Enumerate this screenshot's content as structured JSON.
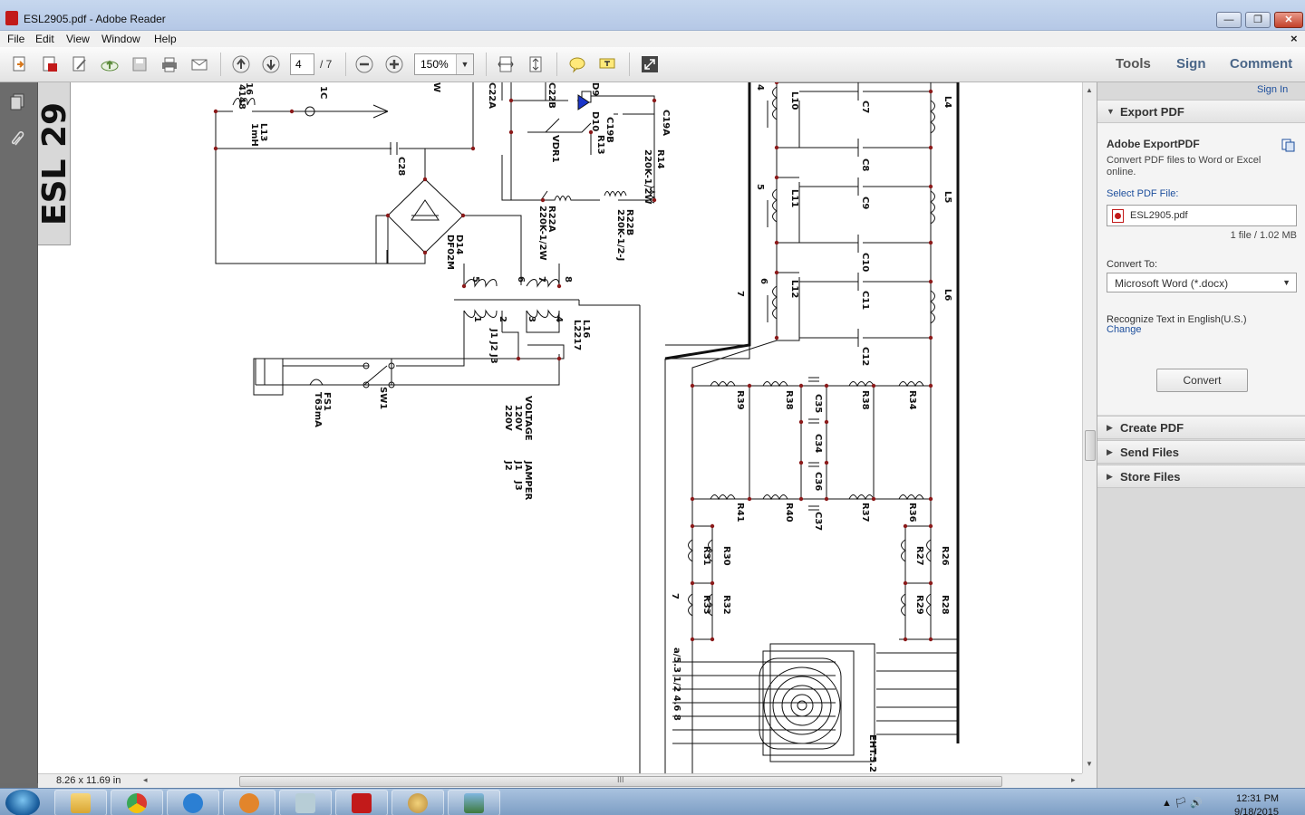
{
  "window": {
    "title": "ESL2905.pdf - Adobe Reader",
    "min": "—",
    "max": "❐",
    "close": "✕"
  },
  "menu": {
    "items": [
      "File",
      "Edit",
      "View",
      "Window",
      "Help"
    ],
    "doc_close": "×"
  },
  "toolbar": {
    "page_current": "4",
    "page_total": "/ 7",
    "zoom": "150%",
    "tabs": {
      "tools": "Tools",
      "sign": "Sign",
      "comment": "Comment"
    }
  },
  "document": {
    "banner_text": "ESL 29",
    "labels": {
      "l13": "L13",
      "l13_val": "1mH",
      "n4148": "4148",
      "n16": "16",
      "n1c": "1C",
      "nw": "W",
      "c28": "C28",
      "c22a": "C22A",
      "c22b": "C22B",
      "d9": "D9",
      "d10": "D10",
      "c19b": "C19B",
      "c19a": "C19A",
      "vdr1": "VDR1",
      "r13": "R13",
      "r14": "R14",
      "r14_val": "220K-1/2W",
      "r22a": "R22A",
      "r22a_val": "220K-1/2W",
      "r22b": "R22B",
      "r22b_val": "220K-1/2-J",
      "d14": "D14",
      "d14_val": "DF02M",
      "p5": "5",
      "p6": "6",
      "p7": "7",
      "p8": "8",
      "p1": "1",
      "p2": "2",
      "p3": "3",
      "p4": "4",
      "l16": "L16",
      "l16_val": "L2217",
      "j1": "J1",
      "j2": "J2",
      "j3": "J3",
      "fs1": "FS1",
      "fs1_val": "T63mA",
      "sw1": "SW1",
      "voltage": "VOLTAGE",
      "v120": "120V",
      "v220": "220V",
      "jamper": "JAMPER",
      "jj1": "J1",
      "jj2": "J2",
      "jj3": "J3",
      "l10": "L10",
      "l11": "L11",
      "l12": "L12",
      "l4": "L4",
      "l5": "L5",
      "l6": "L6",
      "c7": "C7",
      "c8": "C8",
      "c9": "C9",
      "c10": "C10",
      "c11": "C11",
      "c12": "C12",
      "n4": "4",
      "n5": "5",
      "n6": "6",
      "n7": "7",
      "r39": "R39",
      "r38a": "R38",
      "c35": "C35",
      "r38b": "R38",
      "r34": "R34",
      "c34": "C34",
      "c36": "C36",
      "r41": "R41",
      "r40": "R40",
      "c37": "C37",
      "r37": "R37",
      "r36": "R36",
      "r31": "R31",
      "r30": "R30",
      "r33": "R33",
      "r32": "R32",
      "r27": "R27",
      "r26": "R26",
      "r29": "R29",
      "r28": "R28",
      "n7b": "7",
      "pins": "a/5.3 1/2 4.6 8",
      "eht": "EHT.5.2"
    }
  },
  "statusbar": {
    "page_size": "8.26 x 11.69 in",
    "left_arrow": "◂",
    "right_arrow": "▸",
    "grip": "III"
  },
  "rightpane": {
    "sign_in": "Sign In",
    "export_header": "Export PDF",
    "export_title": "Adobe ExportPDF",
    "export_desc": "Convert PDF files to Word or Excel online.",
    "select_label": "Select PDF File:",
    "file_name": "ESL2905.pdf",
    "file_info": "1 file / 1.02 MB",
    "convert_to_label": "Convert To:",
    "convert_to_value": "Microsoft Word (*.docx)",
    "recognize_text": "Recognize Text in English(U.S.)",
    "change_link": "Change",
    "convert_button": "Convert",
    "sections": [
      "Create PDF",
      "Send Files",
      "Store Files"
    ]
  },
  "taskbar": {
    "time": "12:31 PM",
    "date": "9/18/2015",
    "tray": "▲ 🏳 🔊"
  },
  "colors": {
    "accent_blue": "#1c4e9c",
    "tab_blue": "#4a6688",
    "pdf_red": "#c21a1a",
    "wire_red": "#8b1a1a"
  }
}
